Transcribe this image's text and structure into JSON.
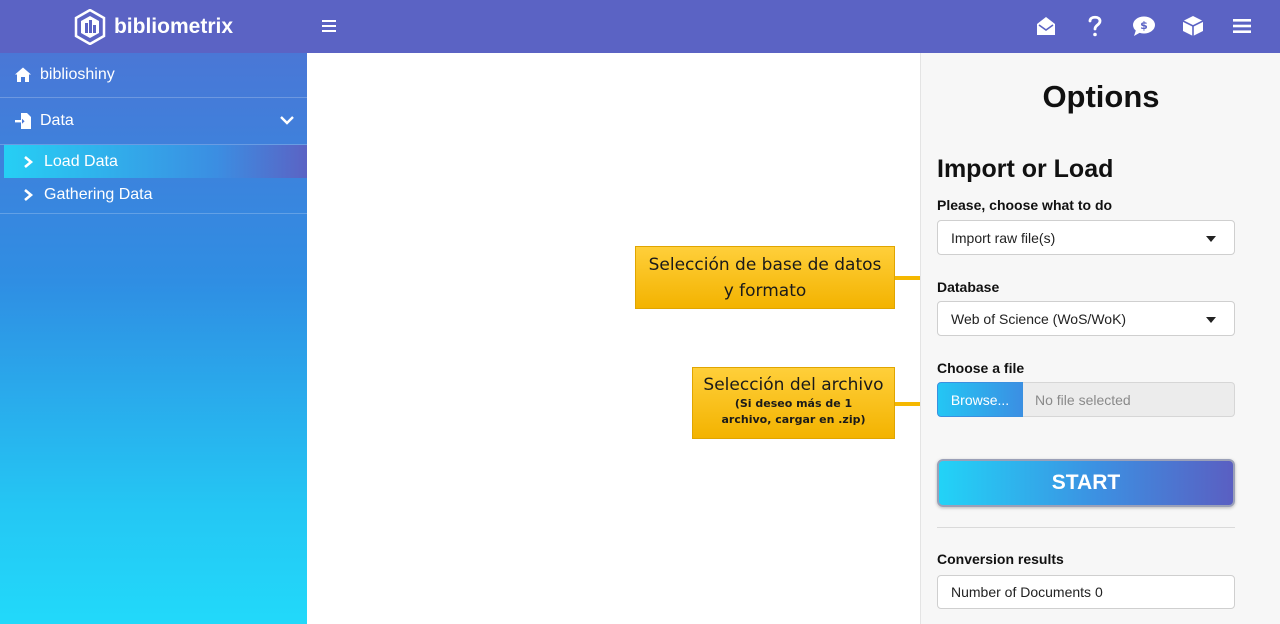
{
  "app": {
    "brand_name": "bibliometrix",
    "accent_color": "#5b63c4",
    "header_icons": [
      "envelope-open-icon",
      "question-icon",
      "comment-dollar-icon",
      "cube-icon",
      "bars-icon"
    ]
  },
  "sidebar": {
    "home_label": "biblioshiny",
    "data_label": "Data",
    "items": [
      {
        "label": "Load Data",
        "active": true
      },
      {
        "label": "Gathering Data",
        "active": false
      }
    ]
  },
  "options": {
    "title": "Options",
    "section_title": "Import or Load",
    "choose_label": "Please, choose what to do",
    "choose_value": "Import raw file(s)",
    "database_label": "Database",
    "database_value": "Web of Science (WoS/WoK)",
    "file_label": "Choose a file",
    "browse_label": "Browse...",
    "file_placeholder": "No file selected",
    "start_label": "START",
    "results_label": "Conversion results",
    "results_text": "Number of Documents  0"
  },
  "callouts": {
    "database_note_line1": "Selección de base de datos",
    "database_note_line2": "y formato",
    "file_note_title": "Selección del archivo",
    "file_note_detail_line1": "(Si deseo más de 1",
    "file_note_detail_line2": "archivo, cargar en .zip)"
  }
}
